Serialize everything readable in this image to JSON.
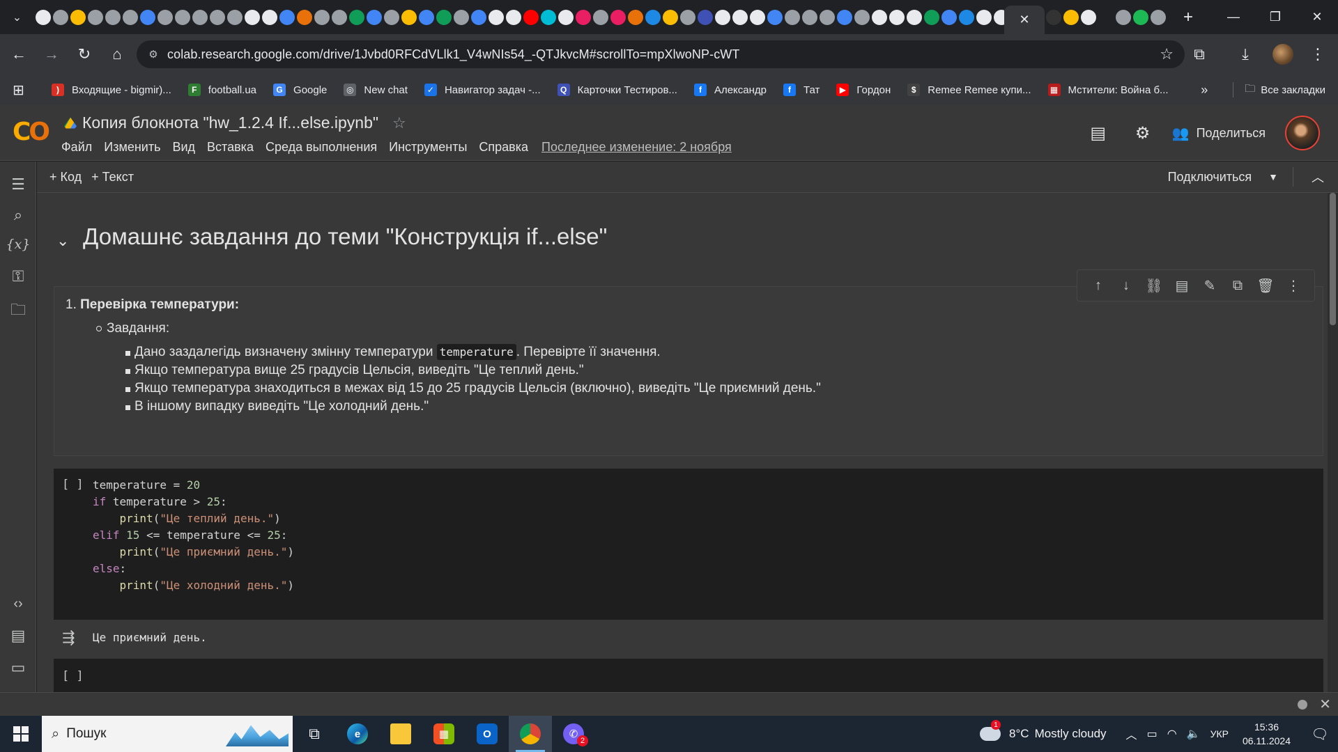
{
  "browser": {
    "active_tab_close": "✕",
    "new_tab": "+",
    "url": "colab.research.google.com/drive/1Jvbd0RFCdVLlk1_V4wNIs54_-QTJkvcM#scrollTo=mpXlwoNP-cWT"
  },
  "bookmarks": {
    "items": [
      {
        "label": "Входящие - bigmir)...",
        "icon_color": "#d93025",
        "glyph": ")"
      },
      {
        "label": "football.ua",
        "icon_color": "#2e7d32",
        "glyph": "F"
      },
      {
        "label": "Google",
        "icon_color": "#4285f4",
        "glyph": "G"
      },
      {
        "label": "New chat",
        "icon_color": "#5f6368",
        "glyph": "◎"
      },
      {
        "label": "Навигатор задач -...",
        "icon_color": "#1a73e8",
        "glyph": "✓"
      },
      {
        "label": "Карточки Тестиров...",
        "icon_color": "#3f51b5",
        "glyph": "Q"
      },
      {
        "label": "Александр",
        "icon_color": "#1877f2",
        "glyph": "f"
      },
      {
        "label": "Тат",
        "icon_color": "#1877f2",
        "glyph": "f"
      },
      {
        "label": "Гордон",
        "icon_color": "#ff0000",
        "glyph": "▶"
      },
      {
        "label": "Remee Remee купи...",
        "icon_color": "#424242",
        "glyph": "$"
      },
      {
        "label": "Мстители: Война б...",
        "icon_color": "#b71c1c",
        "glyph": "▦"
      }
    ],
    "all_bookmarks": "Все закладки"
  },
  "colab": {
    "notebook_title": "Копия блокнота \"hw_1.2.4 If...else.ipynb\"",
    "menu": [
      "Файл",
      "Изменить",
      "Вид",
      "Вставка",
      "Среда выполнения",
      "Инструменты",
      "Справка"
    ],
    "last_modified": "Последнее изменение: 2 ноября",
    "share": "Поделиться",
    "add_code": "+ Код",
    "add_text": "+ Текст",
    "connect": "Подключиться"
  },
  "notebook": {
    "heading": "Домашнє завдання до теми \"Конструкція if...else\"",
    "task_number": "1.",
    "task_title": "Перевірка температури:",
    "subtask": "Завдання:",
    "bullets": {
      "b1_before": "Дано заздалегідь визначену змінну температури ",
      "b1_code": "temperature",
      "b1_after": ". Перевірте її значення.",
      "b2": "Якщо температура вище 25 градусів Цельсія, виведіть \"Це теплий день.\"",
      "b3": "Якщо температура знаходиться в межах від 15 до 25 градусів Цельсія (включно), виведіть \"Це приємний день.\"",
      "b4": "В іншому випадку виведіть \"Це холодний день.\""
    },
    "code_cell": {
      "run_label": "[ ]",
      "lines": {
        "l1_var": "temperature = ",
        "l1_num": "20",
        "l2_kw": "if",
        "l2_rest": " temperature > ",
        "l2_num": "25",
        "l2_end": ":",
        "l3_fn": "print",
        "l3_str": "\"Це теплий день.\"",
        "l4_kw": "elif",
        "l4_num1": "15",
        "l4_mid": " <= temperature <= ",
        "l4_num2": "25",
        "l4_end": ":",
        "l5_fn": "print",
        "l5_str": "\"Це приємний день.\"",
        "l6_kw": "else",
        "l6_end": ":",
        "l7_fn": "print",
        "l7_str": "\"Це холодний день.\""
      }
    },
    "output": "Це приємний день.",
    "empty_cell_run_label": "[ ]"
  },
  "taskbar": {
    "search_placeholder": "Пошук",
    "weather_temp": "8°C",
    "weather_desc": "Mostly cloudy",
    "weather_badge": "1",
    "viber_badge": "2",
    "lang": "УКР",
    "time": "15:36",
    "date": "06.11.2024"
  },
  "colors": {
    "colab_orange": "#f9ab00",
    "background": "#383838",
    "code_bg": "#1e1e1e"
  }
}
